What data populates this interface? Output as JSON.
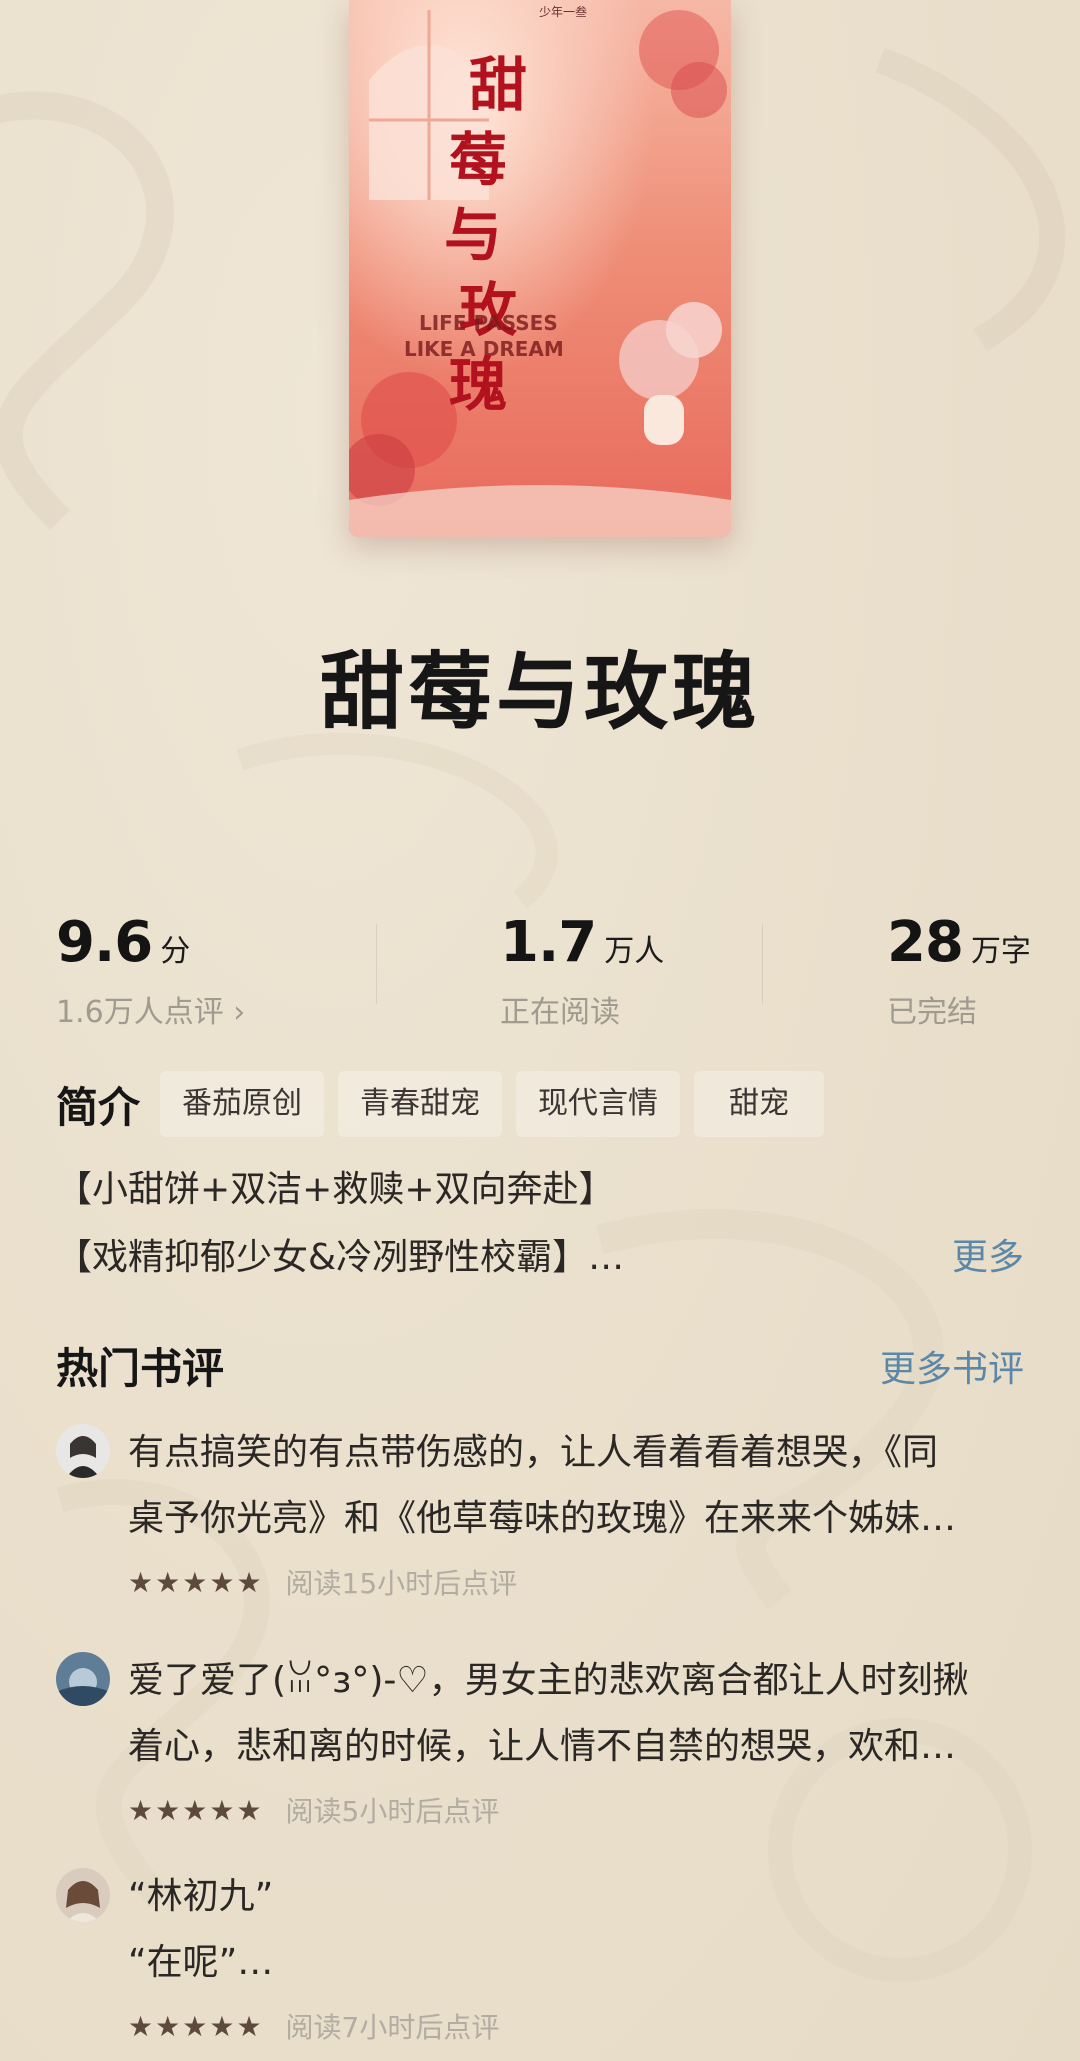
{
  "book": {
    "title": "甜莓与玫瑰",
    "cover": {
      "title_glyphs": [
        "甜",
        "莓",
        "与",
        "玫",
        "瑰"
      ],
      "english_line1": "LIFE PASSES",
      "english_line2": "LIKE A DREAM",
      "author_tag": "少年一叁"
    }
  },
  "stats": {
    "rating": {
      "value": "9.6",
      "unit": "分",
      "sub": "1.6万人点评 ›"
    },
    "readers": {
      "value": "1.7",
      "unit": "万人",
      "sub": "正在阅读"
    },
    "words": {
      "value": "28",
      "unit": "万字",
      "sub": "已完结"
    }
  },
  "intro": {
    "label": "简介",
    "tags": [
      "番茄原创",
      "青春甜宠",
      "现代言情",
      "甜宠"
    ],
    "line1": "【小甜饼+双洁+救赎+双向奔赴】",
    "line2": "【戏精抑郁少女&冷冽野性校霸】…",
    "more": "更多"
  },
  "reviews_section": {
    "title": "热门书评",
    "more": "更多书评",
    "items": [
      {
        "line1": "有点搞笑的有点带伤感的，让人看着看着想哭，《同",
        "line2": "桌予你光亮》和《他草莓味的玫瑰》在来来个姊妹…",
        "stars": 5,
        "meta": "阅读15小时后点评"
      },
      {
        "line1": "爱了爱了(ꈍ°з°)-♡，男女主的悲欢离合都让人时刻揪",
        "line2": "着心，悲和离的时候，让人情不自禁的想哭，欢和…",
        "stars": 5,
        "meta": "阅读5小时后点评"
      },
      {
        "line1": "“林初九”",
        "line2": "“在呢”…",
        "stars": 5,
        "meta": "阅读7小时后点评"
      }
    ]
  },
  "colors": {
    "link": "#5b87a8",
    "star": "#5d4a3c",
    "background": "#eae0cd"
  }
}
